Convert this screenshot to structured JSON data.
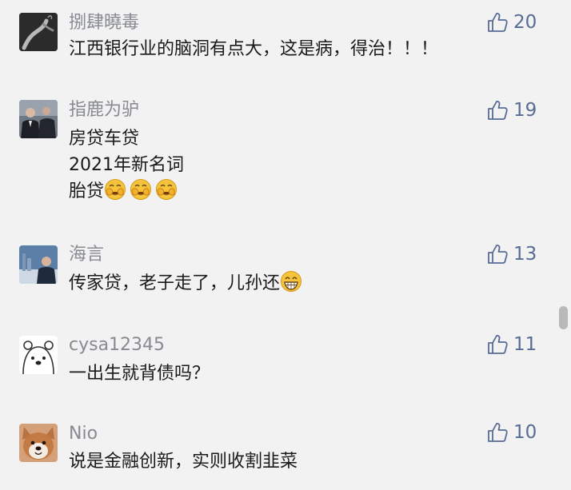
{
  "comments": [
    {
      "username": "捌肆曉毒",
      "likes": "20",
      "avatar": "hand-smoke-avatar",
      "lines": [
        "江西银行业的脑洞有点大，这是病，得治！！！"
      ]
    },
    {
      "username": "指鹿为驴",
      "likes": "19",
      "avatar": "suited-men-avatar",
      "lines": [
        "房贷车贷",
        "2021年新名词",
        "胎贷"
      ],
      "trailing_emoji": [
        "facepalm-emoji",
        "facepalm-emoji",
        "facepalm-emoji"
      ]
    },
    {
      "username": "海言",
      "likes": "13",
      "avatar": "person-city-avatar",
      "lines": [
        "传家贷，老子走了，儿孙还"
      ],
      "trailing_emoji": [
        "grin-emoji"
      ]
    },
    {
      "username": "cysa12345",
      "likes": "11",
      "avatar": "polar-bear-avatar",
      "lines": [
        "一出生就背债吗？"
      ]
    },
    {
      "username": "Nio",
      "likes": "10",
      "avatar": "shiba-dog-avatar",
      "lines": [
        "说是金融创新，实则收割韭菜"
      ]
    }
  ],
  "colors": {
    "background": "#f2f2f2",
    "username": "#888a92",
    "like_accent": "#576b95",
    "text": "#1a1a1a"
  },
  "icons": {
    "like": "thumbs-up-outline-icon"
  }
}
